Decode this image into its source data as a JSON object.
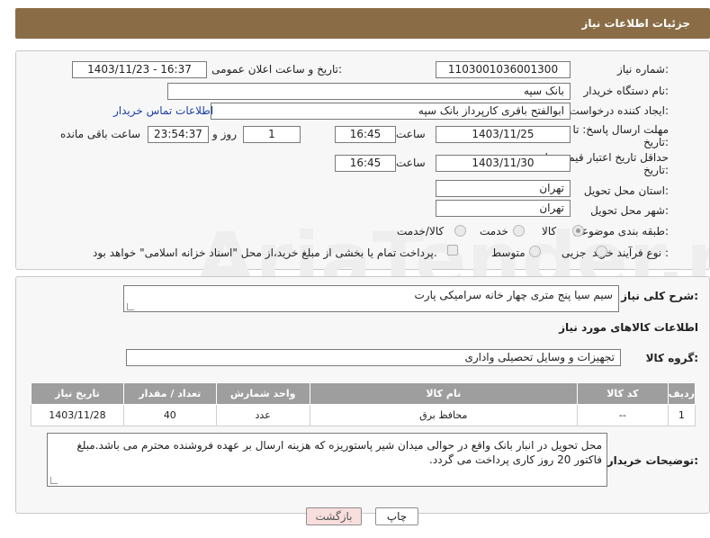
{
  "header": {
    "title": "جزئیات اطلاعات نیاز"
  },
  "form": {
    "need_number_label": "شماره نیاز:",
    "need_number": "1103001036001300",
    "announce_label": "تاریخ و ساعت اعلان عمومی:",
    "announce_value": "1403/11/23 - 16:37",
    "buyer_org_label": "نام دستگاه خریدار:",
    "buyer_org": "بانک سپه",
    "creator_label": "ایجاد کننده درخواست:",
    "creator": "ابوالفتح باقری کارپرداز بانک سپه",
    "contact_link": "اطلاعات تماس خریدار",
    "deadline_label_1": "مهلت ارسال پاسخ: تا",
    "deadline_label_2": "تاریخ:",
    "deadline_date": "1403/11/25",
    "time_label": "ساعت",
    "deadline_time": "16:45",
    "days_value": "1",
    "days_label": "روز و",
    "remaining_value": "23:54:37",
    "remaining_label": "ساعت باقی مانده",
    "validity_label_1": "حداقل تاریخ اعتبار قیمت: تا",
    "validity_label_2": "تاریخ:",
    "validity_date": "1403/11/30",
    "validity_time_label": "ساعت",
    "validity_time": "16:45",
    "province_label": "استان محل تحویل:",
    "province": "تهران",
    "city_label": "شهر محل تحویل:",
    "city": "تهران",
    "category_label": "طبقه بندی موضوعی:",
    "category_options": [
      "کالا",
      "خدمت",
      "کالا/خدمت"
    ],
    "category_selected": "کالا",
    "process_label": "نوع فرآیند خرید :",
    "process_options": [
      "جزیی",
      "متوسط"
    ],
    "payment_note": "پرداخت تمام یا بخشی از مبلغ خرید،از محل \"اسناد خزانه اسلامی\" خواهد بود."
  },
  "watermark": "AriaTender.net",
  "description": {
    "label": "شرح کلی نیاز:",
    "text": "سیم سیا پنج متری چهار خانه سرامیکی پارت",
    "goods_info_title": "اطلاعات کالاهای مورد نیاز",
    "group_label": "گروه کالا:",
    "group_value": "تجهیزات و وسایل تحصیلی واداری"
  },
  "table": {
    "headers": [
      "ردیف",
      "کد کالا",
      "نام کالا",
      "واحد شمارش",
      "تعداد / مقدار",
      "تاریخ نیاز"
    ],
    "rows": [
      [
        "1",
        "--",
        "محافظ برق",
        "عدد",
        "40",
        "1403/11/28"
      ]
    ]
  },
  "buyer_notes": {
    "label": "توضیحات خریدار:",
    "text": "محل تحویل در انبار بانک واقع در حوالی میدان شیر پاستوریزه که هزینه ارسال بر عهده فروشنده محترم می باشد.مبلغ فاکتور 20 روز کاری پرداخت می گردد."
  },
  "buttons": {
    "print": "چاپ",
    "back": "بازگشت"
  },
  "colors": {
    "header_bg": "#8a6d47",
    "table_header_bg": "#9e9e9e",
    "back_button_bg": "#f9dede"
  }
}
